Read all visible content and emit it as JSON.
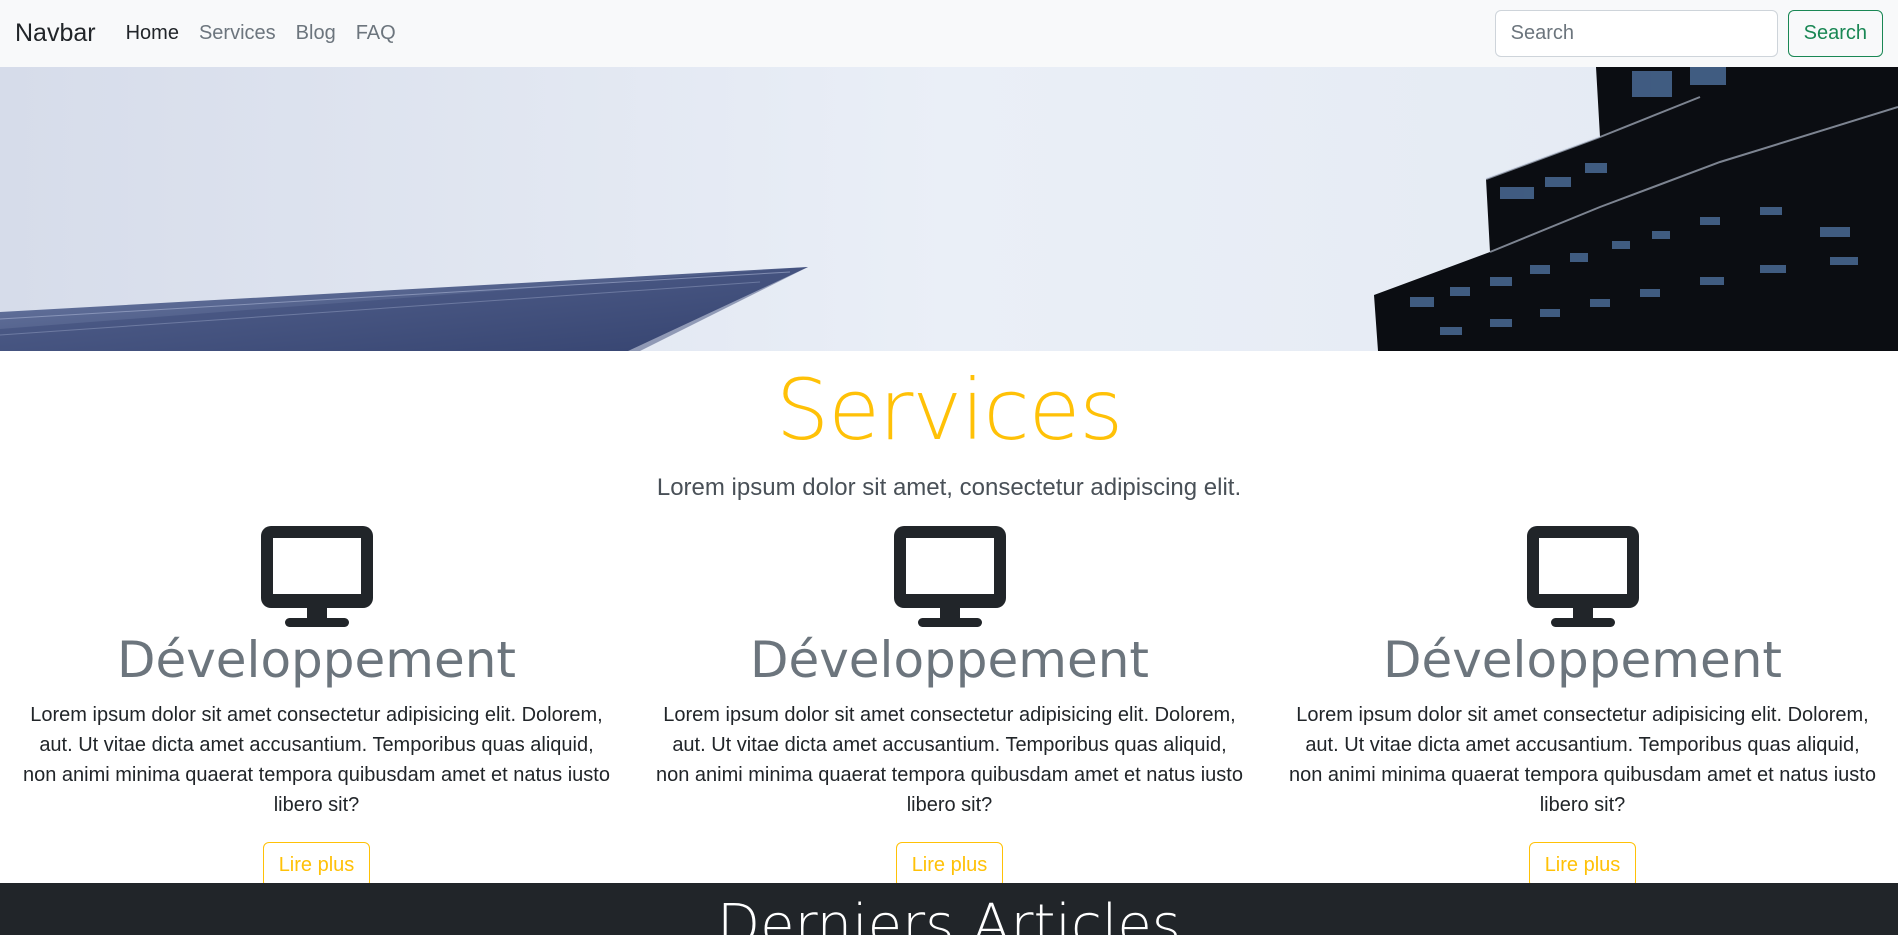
{
  "navbar": {
    "brand": "Navbar",
    "links": [
      {
        "label": "Home",
        "active": true
      },
      {
        "label": "Services",
        "active": false
      },
      {
        "label": "Blog",
        "active": false
      },
      {
        "label": "FAQ",
        "active": false
      }
    ],
    "search_placeholder": "Search",
    "search_button": "Search"
  },
  "hero": {
    "image": "city-buildings-looking-up"
  },
  "services": {
    "title": "Services",
    "subtitle": "Lorem ipsum dolor sit amet, consectetur adipiscing elit.",
    "cards": [
      {
        "icon": "monitor-icon",
        "title": "Développement",
        "text": "Lorem ipsum dolor sit amet consectetur adipisicing elit. Dolorem, aut. Ut vitae dicta amet accusantium. Temporibus quas aliquid, non animi minima quaerat tempora quibusdam amet et natus iusto libero sit?",
        "button": "Lire plus"
      },
      {
        "icon": "monitor-icon",
        "title": "Développement",
        "text": "Lorem ipsum dolor sit amet consectetur adipisicing elit. Dolorem, aut. Ut vitae dicta amet accusantium. Temporibus quas aliquid, non animi minima quaerat tempora quibusdam amet et natus iusto libero sit?",
        "button": "Lire plus"
      },
      {
        "icon": "monitor-icon",
        "title": "Développement",
        "text": "Lorem ipsum dolor sit amet consectetur adipisicing elit. Dolorem, aut. Ut vitae dicta amet accusantium. Temporibus quas aliquid, non animi minima quaerat tempora quibusdam amet et natus iusto libero sit?",
        "button": "Lire plus"
      }
    ]
  },
  "articles": {
    "title": "Derniers Articles"
  },
  "colors": {
    "accent": "#ffc107",
    "success": "#198754",
    "dark": "#212529",
    "muted": "#6c757d"
  }
}
